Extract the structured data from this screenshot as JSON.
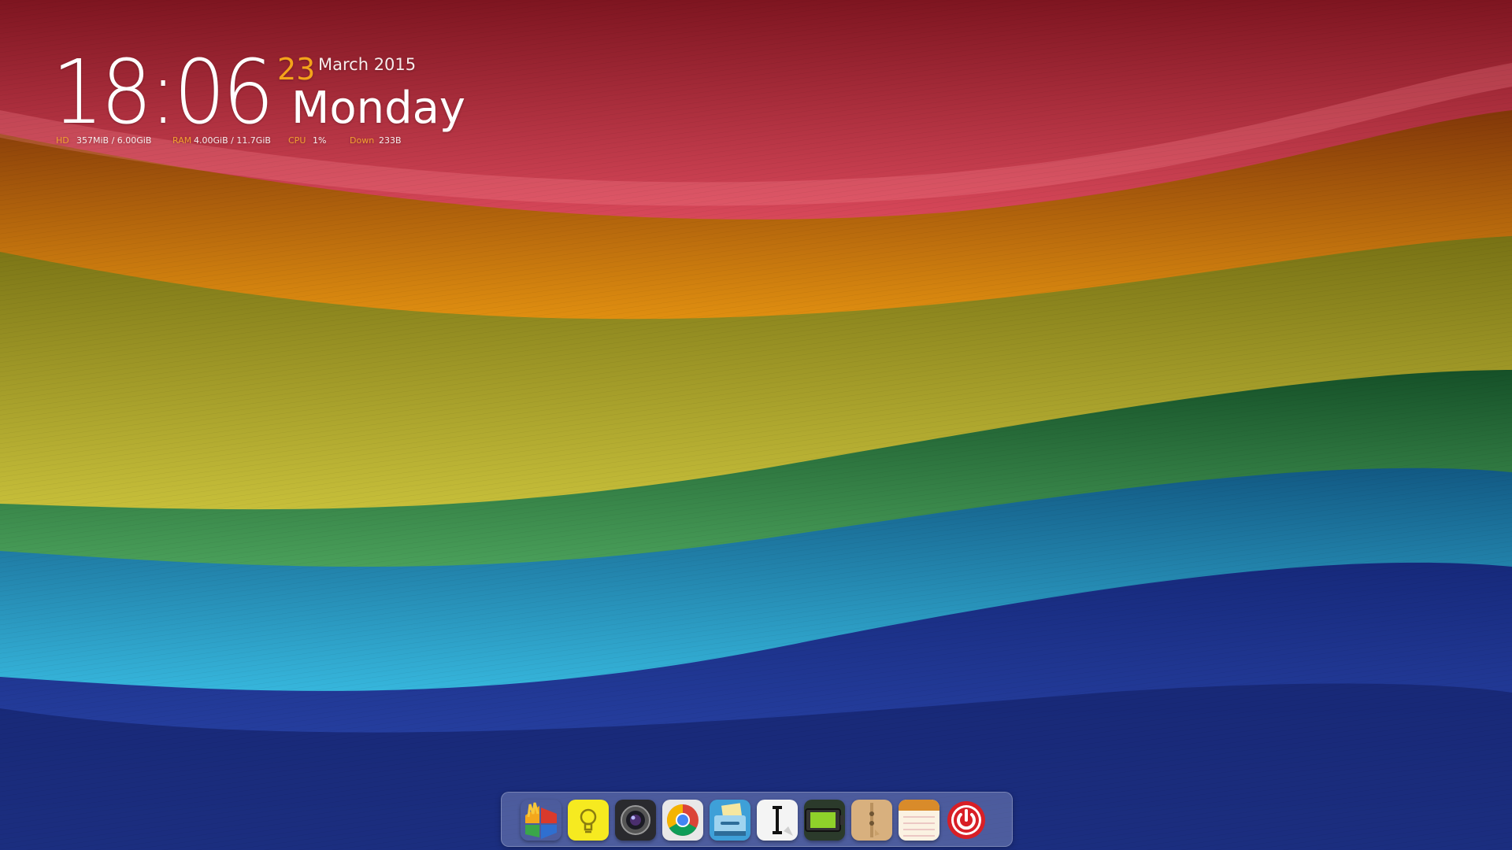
{
  "clock": {
    "time": "18:06",
    "day": "23",
    "month_year": "March 2015",
    "weekday": "Monday"
  },
  "stats": {
    "hd_label": "HD",
    "hd_value": "357MiB  / 6.00GiB",
    "ram_label": "RAM",
    "ram_value": "4.00GiB / 11.7GiB",
    "cpu_label": "CPU",
    "cpu_value": "1%",
    "down_label": "Down",
    "down_value": "233B"
  },
  "colors": {
    "accent": "#f4a31a",
    "clock_text": "#ffffff",
    "stripe_red": "#b8283a",
    "stripe_orange": "#c9780e",
    "stripe_yellow": "#b7ae2c",
    "stripe_green": "#2e7a3c",
    "stripe_cyan": "#1c8cb8",
    "stripe_blue": "#1f3590"
  },
  "dock": {
    "items": [
      {
        "name": "multicolor-app-icon"
      },
      {
        "name": "lightbulb-icon"
      },
      {
        "name": "camera-lens-icon"
      },
      {
        "name": "chrome-browser-icon"
      },
      {
        "name": "file-manager-icon"
      },
      {
        "name": "text-editor-icon"
      },
      {
        "name": "battery-icon"
      },
      {
        "name": "archive-manager-icon"
      },
      {
        "name": "notes-icon"
      },
      {
        "name": "power-icon"
      }
    ]
  }
}
